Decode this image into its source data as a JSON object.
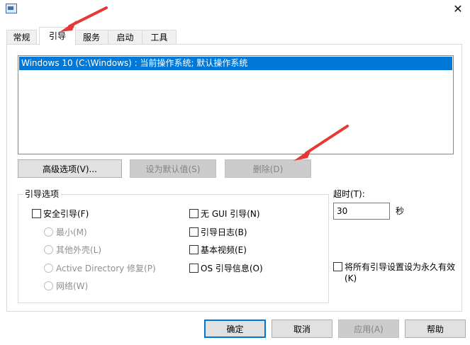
{
  "window": {
    "close_glyph": "✕"
  },
  "tabs": [
    {
      "label": "常规"
    },
    {
      "label": "引导"
    },
    {
      "label": "服务"
    },
    {
      "label": "启动"
    },
    {
      "label": "工具"
    }
  ],
  "os_list": {
    "items": [
      "Windows 10 (C:\\Windows) : 当前操作系统; 默认操作系统"
    ]
  },
  "buttons": {
    "advanced": "高级选项(V)...",
    "set_default": "设为默认值(S)",
    "delete": "删除(D)",
    "ok": "确定",
    "cancel": "取消",
    "apply": "应用(A)",
    "help": "帮助"
  },
  "boot_options": {
    "title": "引导选项",
    "safe_boot": "安全引导(F)",
    "minimal": "最小(M)",
    "alternate_shell": "其他外壳(L)",
    "active_directory": "Active Directory 修复(P)",
    "network": "网络(W)",
    "no_gui": "无 GUI 引导(N)",
    "boot_log": "引导日志(B)",
    "base_video": "基本视频(E)",
    "os_boot_info": "OS 引导信息(O)"
  },
  "timeout": {
    "label": "超时(T):",
    "value": "30",
    "unit": "秒"
  },
  "permanent": {
    "label_line1": "将所有引导设置设为永久有效",
    "label_line2": "(K)"
  },
  "colors": {
    "selection": "#0078d7",
    "annotation_arrow": "#e53935"
  }
}
